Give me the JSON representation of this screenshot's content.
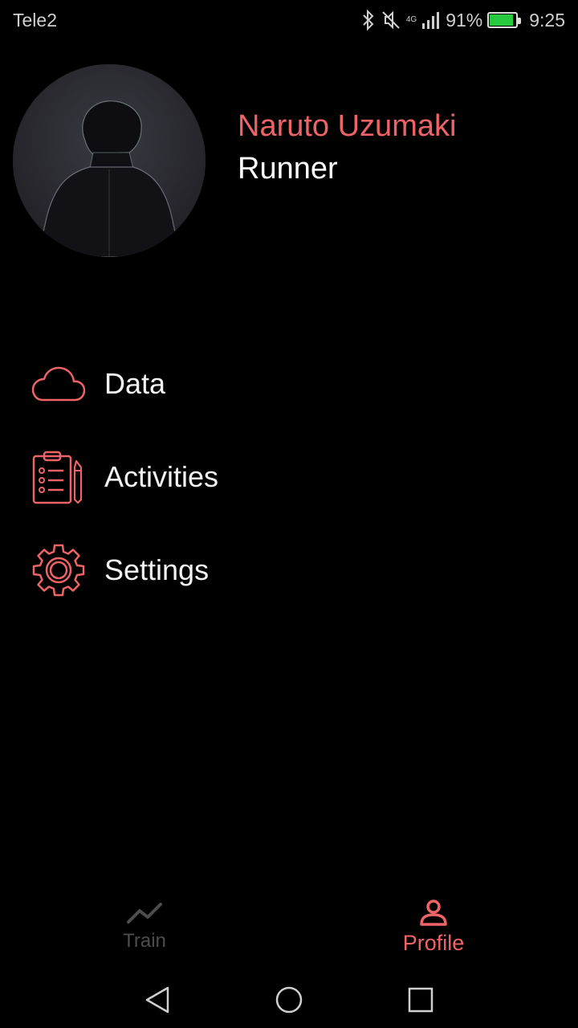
{
  "status_bar": {
    "carrier": "Tele2",
    "network": "4G",
    "battery_percent": "91%",
    "battery_level": 0.91,
    "time": "9:25",
    "icons": [
      "bluetooth-icon",
      "mute-icon",
      "signal-icon",
      "battery-icon"
    ]
  },
  "profile": {
    "name": "Naruto Uzumaki",
    "role": "Runner",
    "avatar_icon": "avatar"
  },
  "menu": {
    "items": [
      {
        "label": "Data",
        "icon": "cloud-icon"
      },
      {
        "label": "Activities",
        "icon": "clipboard-icon"
      },
      {
        "label": "Settings",
        "icon": "gear-icon"
      }
    ]
  },
  "bottom_nav": {
    "tabs": [
      {
        "label": "Train",
        "icon": "trend-line-icon",
        "active": false
      },
      {
        "label": "Profile",
        "icon": "person-icon",
        "active": true
      }
    ]
  },
  "colors": {
    "accent": "#ee6466",
    "background": "#000000",
    "inactive": "#4d4d4d"
  }
}
